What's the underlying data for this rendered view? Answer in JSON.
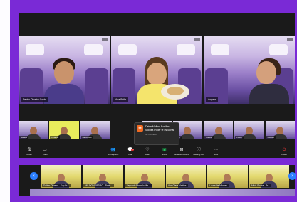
{
  "speakers": [
    {
      "name": "Danilo Oliveira Costa",
      "active": false
    },
    {
      "name": "Ana Bella",
      "active": true
    },
    {
      "name": "Angela",
      "active": false
    }
  ],
  "gallery": [
    {
      "name": "Manuel"
    },
    {
      "name": "P.Nardo"
    },
    {
      "name": "Raimundo"
    },
    {
      "name": "Mateus"
    },
    {
      "name": "Kevin"
    },
    {
      "name": "Juliana"
    },
    {
      "name": "Pedro"
    },
    {
      "name": "Larissa"
    }
  ],
  "notification": {
    "icon": "zoom-app-icon",
    "text": "Daise Mellina Bonifax - Solicita Poder te escuchar",
    "time": "há 1 minuto"
  },
  "toolbar": {
    "audio": "Audio",
    "video": "Video",
    "participants": "Participants",
    "chat": "Chat",
    "chat_badge": "45",
    "react": "React",
    "share": "Share",
    "breakout": "Breakout Rooms",
    "meeting_info": "Meeting Info",
    "more": "More",
    "leave": "Leave"
  },
  "carousel": [
    {
      "name": "Dalton Oliveira - Sup Pr..."
    },
    {
      "name": "MC DOM PEDRO - Profe..."
    },
    {
      "name": "Segundo Marcelo Ma..."
    },
    {
      "name": "Ana Clara Martins"
    },
    {
      "name": "Laura De Moraes"
    },
    {
      "name": "Alicia Souza - Pr..."
    }
  ],
  "colors": {
    "frame": "#7a2ad6",
    "active_speaker": "#f2d40e",
    "nav": "#2b7fff",
    "share": "#22c55e",
    "leave": "#ff3b3b"
  }
}
